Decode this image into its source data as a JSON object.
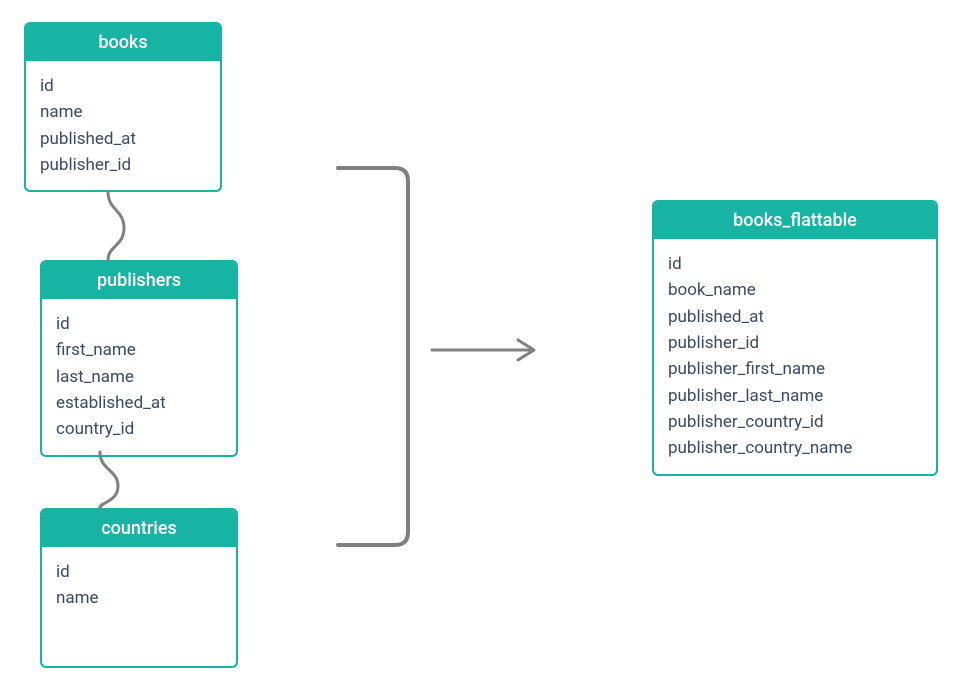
{
  "tables": {
    "books": {
      "title": "books",
      "fields": [
        "id",
        "name",
        "published_at",
        "publisher_id"
      ]
    },
    "publishers": {
      "title": "publishers",
      "fields": [
        "id",
        "first_name",
        "last_name",
        "established_at",
        "country_id"
      ]
    },
    "countries": {
      "title": "countries",
      "fields": [
        "id",
        "name"
      ]
    },
    "flattable": {
      "title": "books_flattable",
      "fields": [
        "id",
        "book_name",
        "published_at",
        "publisher_id",
        "publisher_first_name",
        "publisher_last_name",
        "publisher_country_id",
        "publisher_country_name"
      ]
    }
  },
  "colors": {
    "accent": "#17b3a3",
    "text": "#3b4a63",
    "connector": "#808080"
  }
}
